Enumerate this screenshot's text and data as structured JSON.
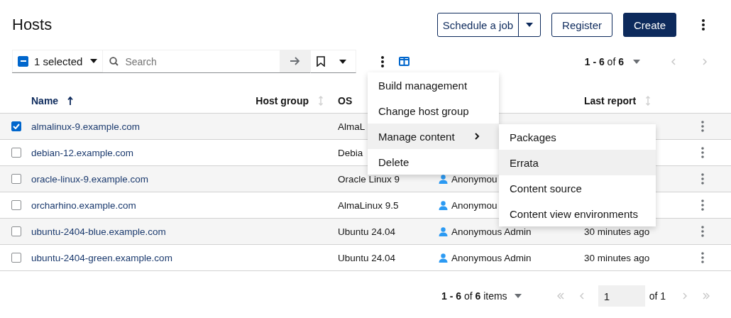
{
  "page": {
    "title": "Hosts"
  },
  "header_actions": [
    {
      "kind": "split",
      "label": "Schedule a job"
    },
    {
      "kind": "secondary",
      "label": "Register"
    },
    {
      "kind": "primary",
      "label": "Create"
    }
  ],
  "toolbar": {
    "bulk_select": {
      "label": "1 selected",
      "indeterminate": true
    },
    "search": {
      "placeholder": "Search"
    },
    "pagination": "**1 - 6** of **6**",
    "pager": [
      {
        "kind": "prev",
        "disabled": true
      },
      {
        "kind": "next",
        "disabled": true
      }
    ]
  },
  "columns": [
    {
      "label": "Name",
      "sorted": true
    },
    {
      "label": "Host group",
      "sorted": false
    },
    {
      "label": "OS"
    },
    {
      "label": "Last report",
      "sorted": false
    }
  ],
  "rows": [
    {
      "selected": true,
      "name": "almalinux-9.example.com",
      "os": "AlmaL"
    },
    {
      "selected": false,
      "name": "debian-12.example.com",
      "os": "Debia"
    },
    {
      "selected": false,
      "name": "oracle-linux-9.example.com",
      "os": "Oracle Linux 9",
      "owner": "Anonymou"
    },
    {
      "selected": false,
      "name": "orcharhino.example.com",
      "os": "AlmaLinux 9.5",
      "owner": "Anonymou"
    },
    {
      "selected": false,
      "name": "ubuntu-2404-blue.example.com",
      "os": "Ubuntu 24.04",
      "owner": "Anonymous Admin",
      "last_report": "30 minutes ago"
    },
    {
      "selected": false,
      "name": "ubuntu-2404-green.example.com",
      "os": "Ubuntu 24.04",
      "owner": "Anonymous Admin",
      "last_report": "30 minutes ago"
    }
  ],
  "actions_menu": [
    {
      "label": "Build management",
      "kind": "action",
      "selected": false
    },
    {
      "label": "Change host group",
      "kind": "action",
      "selected": false
    },
    {
      "label": "Manage content",
      "kind": "submenu",
      "selected": true
    },
    {
      "label": "Delete",
      "kind": "action",
      "selected": false
    }
  ],
  "submenu": [
    {
      "label": "Packages",
      "selected": false
    },
    {
      "label": "Errata",
      "selected": true
    },
    {
      "label": "Content source",
      "selected": false
    },
    {
      "label": "Content view environments",
      "selected": false
    }
  ],
  "footer": {
    "range": "**1 - 6** of **6** items",
    "page": "1",
    "of_pages": "of 1",
    "nav": [
      {
        "kind": "first",
        "disabled": true
      },
      {
        "kind": "prev",
        "disabled": true
      },
      {
        "kind": "next",
        "disabled": true
      },
      {
        "kind": "last",
        "disabled": true
      }
    ]
  }
}
